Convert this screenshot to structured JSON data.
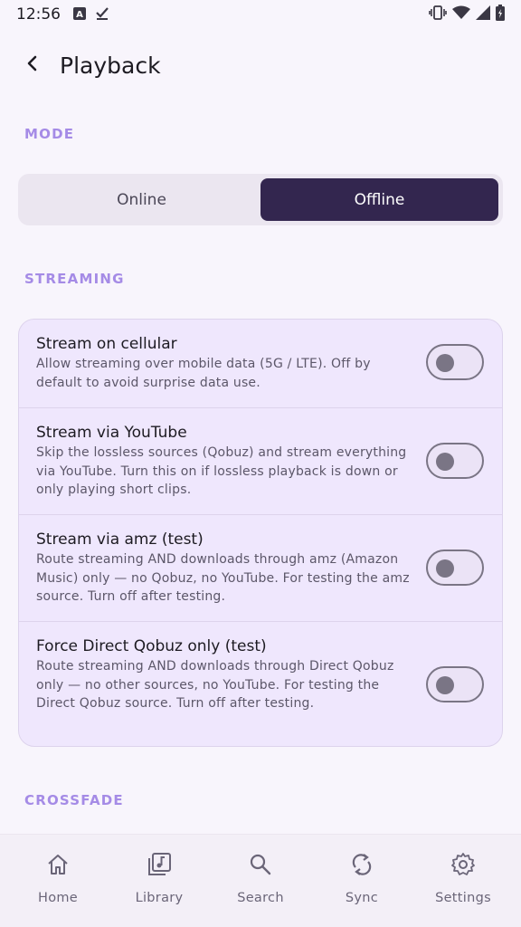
{
  "status": {
    "time": "12:56",
    "icons": [
      "font-a-icon",
      "download-done-icon",
      "vibrate-icon",
      "wifi-icon",
      "signal-icon",
      "battery-charging-icon"
    ]
  },
  "app_bar": {
    "title": "Playback"
  },
  "sections": {
    "mode": "MODE",
    "streaming": "STREAMING",
    "crossfade": "CROSSFADE"
  },
  "mode": {
    "options": [
      "Online",
      "Offline"
    ],
    "selected": "Offline"
  },
  "streaming": {
    "items": [
      {
        "title": "Stream on cellular",
        "desc": "Allow streaming over mobile data (5G / LTE). Off by default to avoid surprise data use.",
        "enabled": false
      },
      {
        "title": "Stream via YouTube",
        "desc": "Skip the lossless sources (Qobuz) and stream everything via YouTube. Turn this on if lossless playback is down or only playing short clips.",
        "enabled": false
      },
      {
        "title": "Stream via amz (test)",
        "desc": "Route streaming AND downloads through amz (Amazon Music) only — no Qobuz, no YouTube. For testing the amz source. Turn off after testing.",
        "enabled": false
      },
      {
        "title": "Force Direct Qobuz only (test)",
        "desc": "Route streaming AND downloads through Direct Qobuz only — no other sources, no YouTube. For testing the Direct Qobuz source. Turn off after testing.",
        "enabled": false
      }
    ]
  },
  "bottom_nav": {
    "items": [
      {
        "label": "Home",
        "icon": "home-icon"
      },
      {
        "label": "Library",
        "icon": "library-icon"
      },
      {
        "label": "Search",
        "icon": "search-icon"
      },
      {
        "label": "Sync",
        "icon": "sync-icon"
      },
      {
        "label": "Settings",
        "icon": "settings-icon"
      }
    ]
  },
  "colors": {
    "accent": "#a58be6",
    "selected_bg": "#33264f",
    "card_bg": "#efe7fd",
    "background": "#f8f5fc"
  }
}
